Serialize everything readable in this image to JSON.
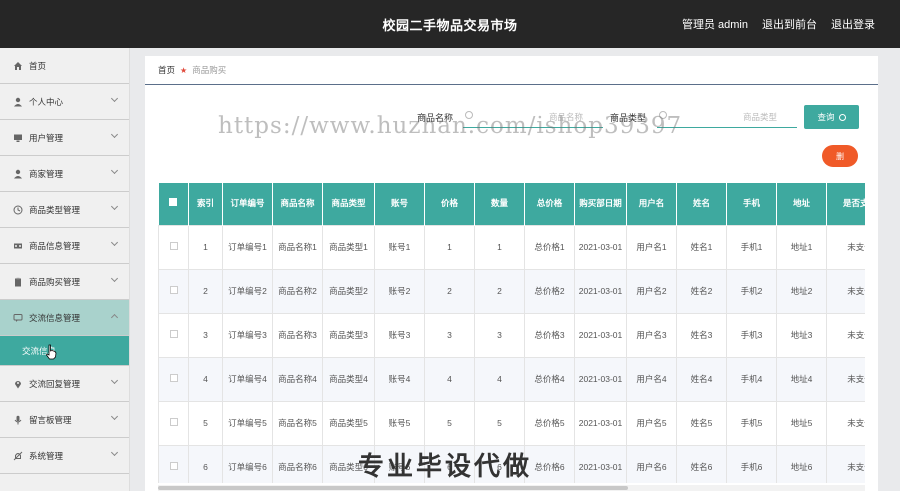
{
  "header": {
    "title": "校园二手物品交易市场",
    "admin_label": "管理员 admin",
    "back_label": "退出到前台",
    "logout_label": "退出登录"
  },
  "sidebar": {
    "items": [
      {
        "label": "首页",
        "icon": "home-icon"
      },
      {
        "label": "个人中心",
        "icon": "user-icon"
      },
      {
        "label": "用户管理",
        "icon": "monitor-icon"
      },
      {
        "label": "商家管理",
        "icon": "user-icon"
      },
      {
        "label": "商品类型管理",
        "icon": "clock-icon"
      },
      {
        "label": "商品信息管理",
        "icon": "film-icon"
      },
      {
        "label": "商品购买管理",
        "icon": "clipboard-icon"
      },
      {
        "label": "交流信息管理",
        "icon": "chat-icon"
      },
      {
        "label": "交流回复管理",
        "icon": "location-icon"
      },
      {
        "label": "留言板管理",
        "icon": "microphone-icon"
      },
      {
        "label": "系统管理",
        "icon": "bell-off-icon"
      }
    ],
    "sub_item": "交流信息"
  },
  "breadcrumb": {
    "home": "首页",
    "current": "商品购买"
  },
  "search": {
    "name_label": "商品名称",
    "name_placeholder": "商品名称",
    "type_label": "商品类型",
    "type_placeholder": "商品类型",
    "query_button": "查询",
    "delete_button": "删"
  },
  "table": {
    "headers": [
      "",
      "索引",
      "订单编号",
      "商品名称",
      "商品类型",
      "账号",
      "价格",
      "数量",
      "总价格",
      "购买部日期",
      "用户名",
      "姓名",
      "手机",
      "地址",
      "是否支付"
    ],
    "rows": [
      [
        "1",
        "订单编号1",
        "商品名称1",
        "商品类型1",
        "账号1",
        "1",
        "1",
        "总价格1",
        "2021-03-01",
        "用户名1",
        "姓名1",
        "手机1",
        "地址1",
        "未支付"
      ],
      [
        "2",
        "订单编号2",
        "商品名称2",
        "商品类型2",
        "账号2",
        "2",
        "2",
        "总价格2",
        "2021-03-01",
        "用户名2",
        "姓名2",
        "手机2",
        "地址2",
        "未支付"
      ],
      [
        "3",
        "订单编号3",
        "商品名称3",
        "商品类型3",
        "账号3",
        "3",
        "3",
        "总价格3",
        "2021-03-01",
        "用户名3",
        "姓名3",
        "手机3",
        "地址3",
        "未支付"
      ],
      [
        "4",
        "订单编号4",
        "商品名称4",
        "商品类型4",
        "账号4",
        "4",
        "4",
        "总价格4",
        "2021-03-01",
        "用户名4",
        "姓名4",
        "手机4",
        "地址4",
        "未支付"
      ],
      [
        "5",
        "订单编号5",
        "商品名称5",
        "商品类型5",
        "账号5",
        "5",
        "5",
        "总价格5",
        "2021-03-01",
        "用户名5",
        "姓名5",
        "手机5",
        "地址5",
        "未支付"
      ],
      [
        "6",
        "订单编号6",
        "商品名称6",
        "商品类型6",
        "账号6",
        "6",
        "6",
        "总价格6",
        "2021-03-01",
        "用户名6",
        "姓名6",
        "手机6",
        "地址6",
        "未支付"
      ]
    ]
  },
  "watermarks": {
    "url": "https://www.huzhan.com/ishop39397",
    "text": "专业毕设代做"
  },
  "colors": {
    "header_bg": "#262626",
    "accent": "#3ea99f",
    "delete": "#f05a28",
    "sidebar_bg": "#f0f0f0"
  }
}
